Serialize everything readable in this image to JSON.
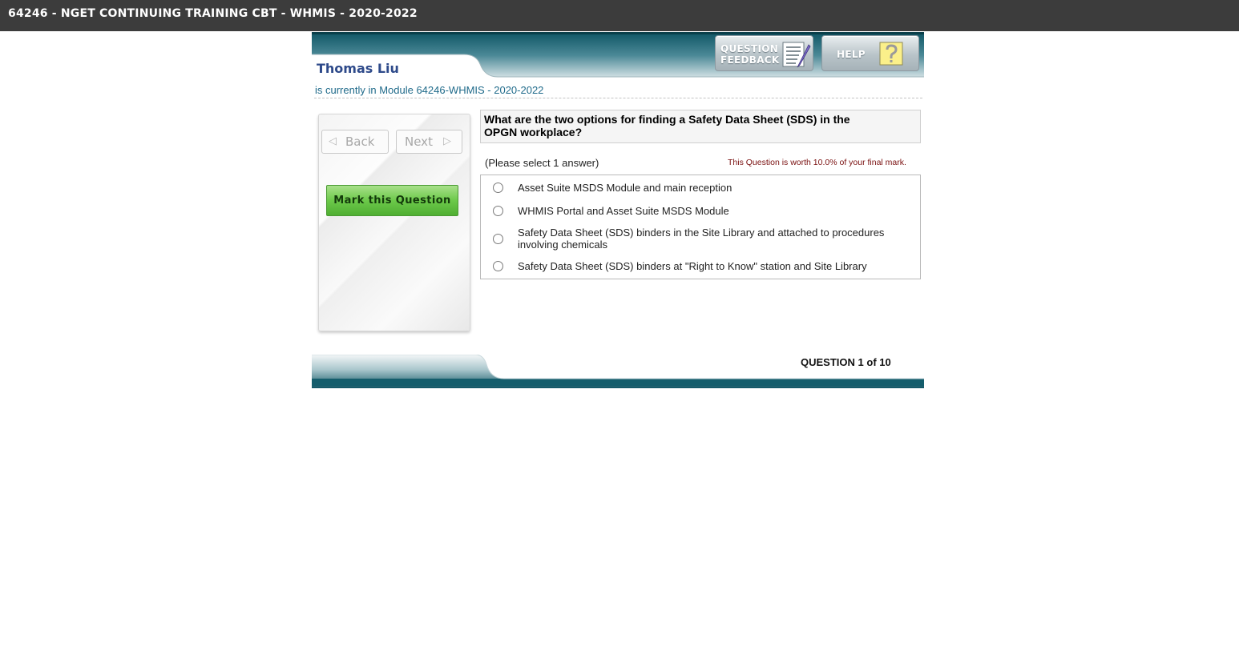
{
  "window": {
    "title": "64246 - NGET CONTINUING TRAINING CBT - WHMIS - 2020-2022"
  },
  "header": {
    "user_name": "Thomas Liu",
    "module_text": "is currently in Module 64246-WHMIS - 2020-2022",
    "feedback_button": {
      "line1": "QUESTION",
      "line2": "FEEDBACK",
      "icon": "notepad-pencil-icon"
    },
    "help_button": {
      "label": "HELP",
      "icon": "question-mark-icon"
    }
  },
  "nav": {
    "back_label": "Back",
    "next_label": "Next",
    "back_arrow": "◁",
    "next_arrow": "▷",
    "mark_label": "Mark this Question"
  },
  "question": {
    "text": "What are the two options for finding a Safety Data Sheet (SDS) in the OPGN workplace?",
    "instruction": "(Please select 1 answer)",
    "worth": "This Question is worth 10.0% of your final mark.",
    "answers": [
      {
        "text": "Asset Suite MSDS Module and main reception",
        "selected": false
      },
      {
        "text": "WHMIS Portal and Asset Suite MSDS Module",
        "selected": false
      },
      {
        "text": "Safety Data Sheet (SDS) binders in the Site Library and attached to procedures involving chemicals",
        "selected": false
      },
      {
        "text": "Safety Data Sheet (SDS) binders at \"Right to Know\" station and Site Library",
        "selected": false
      }
    ]
  },
  "footer": {
    "counter_prefix": "QUESTION",
    "current": "1",
    "of_word": "of",
    "total": "10"
  },
  "colors": {
    "titlebar": "#3c3c3c",
    "band_dark": "#0d4f5c",
    "band_light": "#f2f5f6",
    "mark_button": "#6cc94a",
    "user_name": "#2e4a8a",
    "worth_text": "#7a1010"
  }
}
